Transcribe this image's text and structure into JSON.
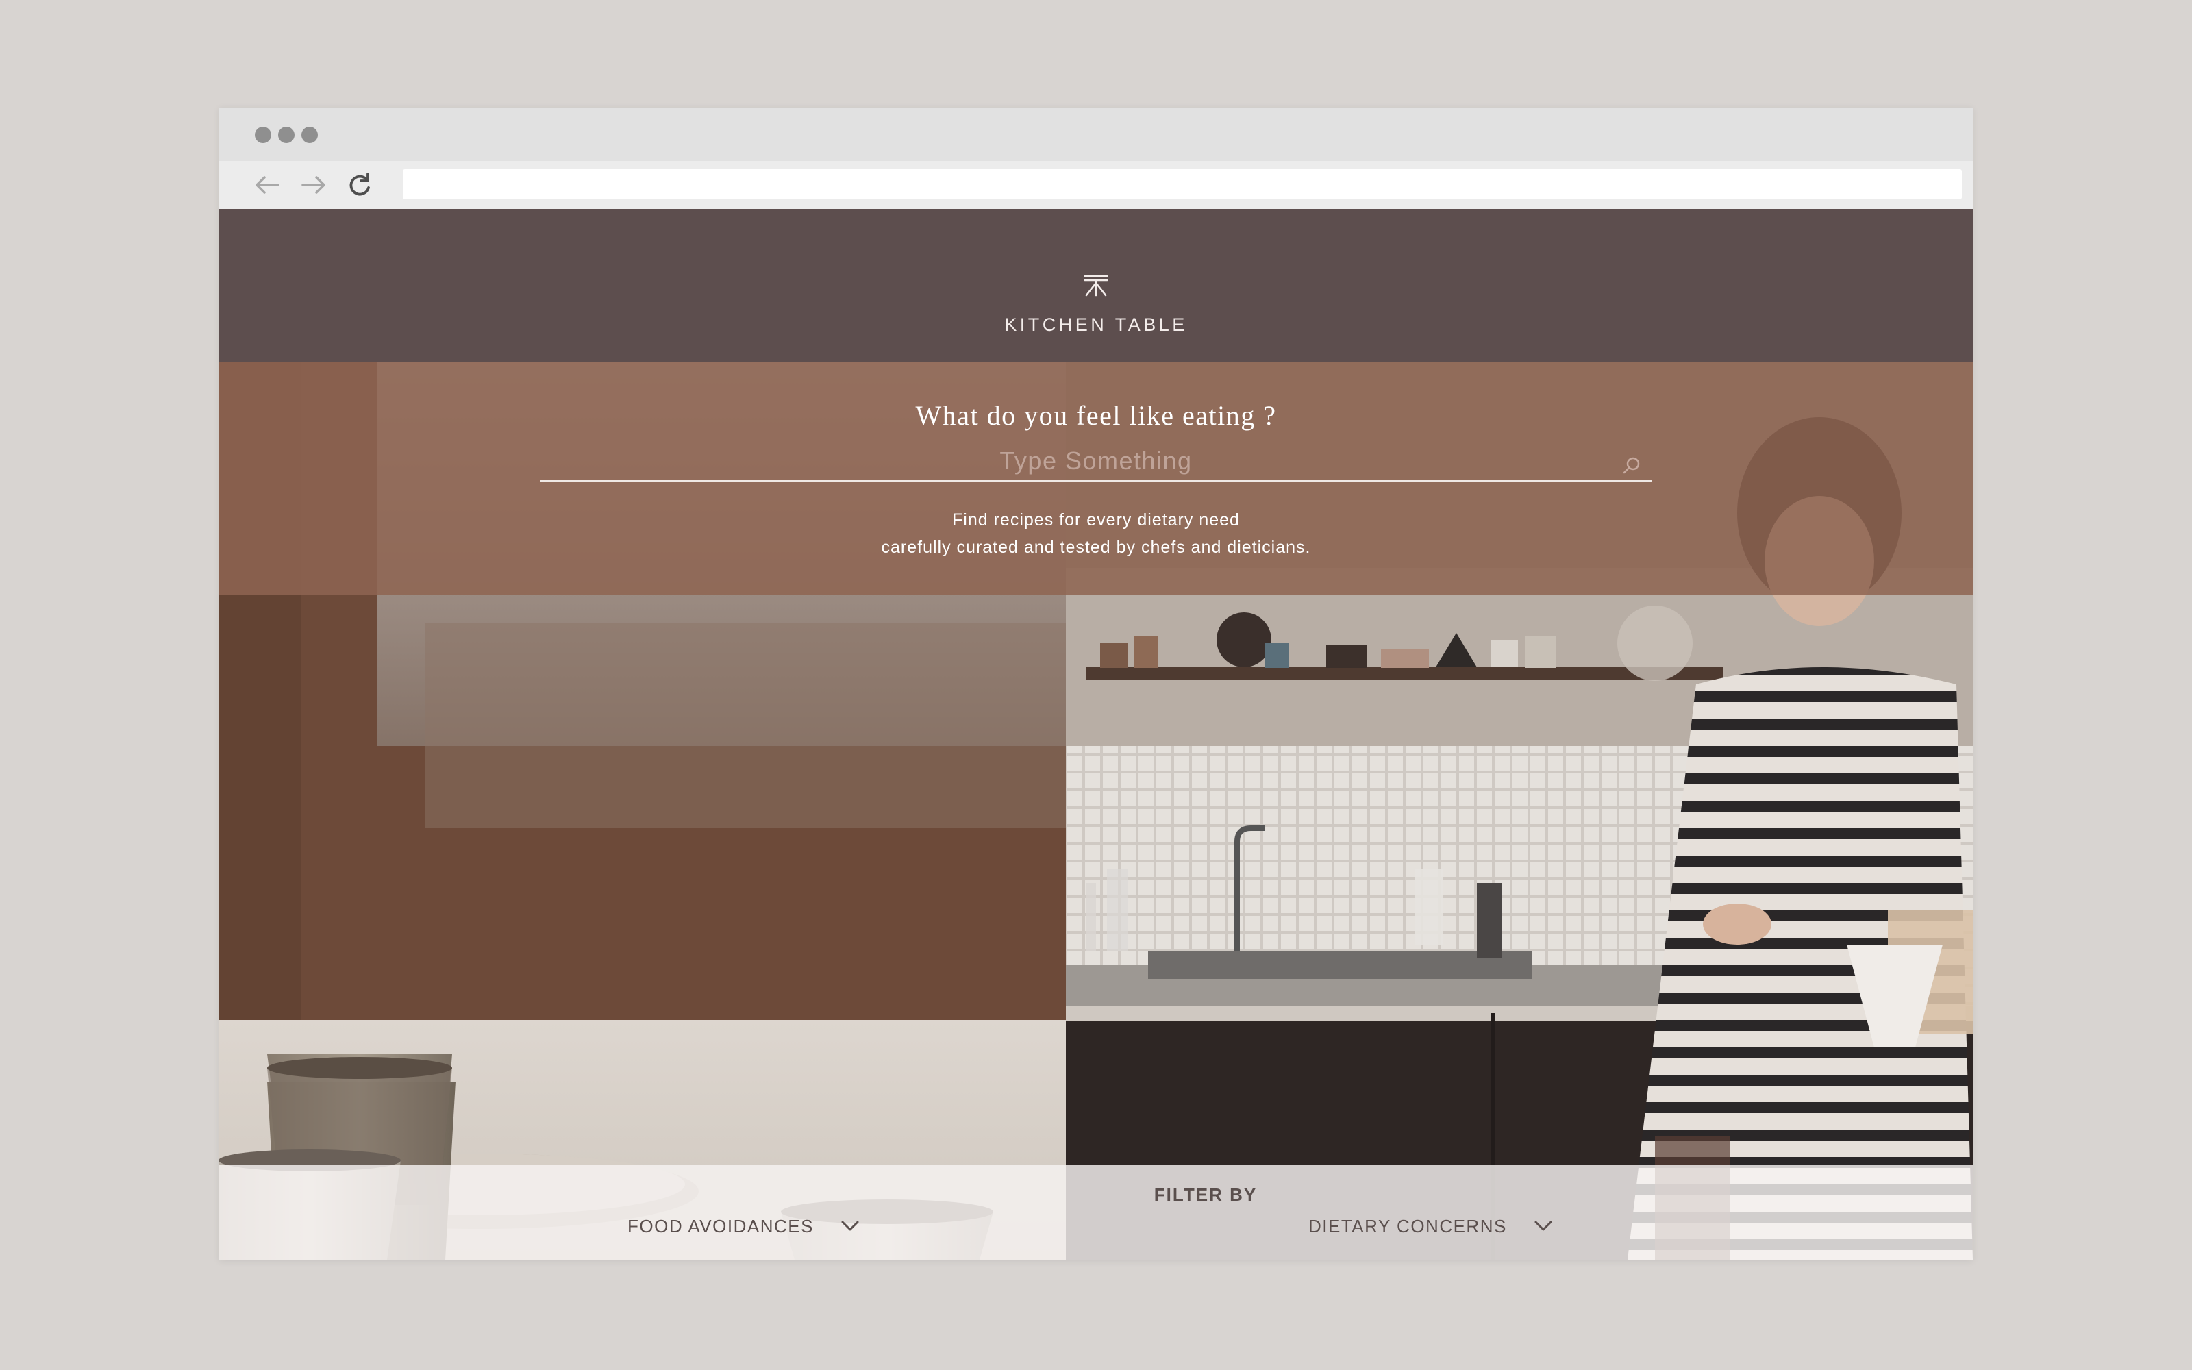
{
  "site": {
    "brand": "KITCHEN TABLE"
  },
  "hero": {
    "question": "What do you feel like eating ?",
    "search_placeholder": "Type Something",
    "tagline_line1": "Find recipes for every dietary need",
    "tagline_line2": "carefully curated and tested by chefs and dieticians."
  },
  "filter": {
    "title": "FILTER BY",
    "dropdowns": [
      {
        "label": "FOOD AVOIDANCES"
      },
      {
        "label": "DIETARY CONCERNS"
      }
    ]
  },
  "colors": {
    "page_background": "#d8d4d1",
    "header": "#5d4e4e",
    "hero_overlay": "#8e6452",
    "filter_text": "#5a4f4d"
  },
  "icons": {
    "window_controls": [
      "window-dot-icon",
      "window-dot-icon",
      "window-dot-icon"
    ],
    "toolbar": [
      "back-arrow-icon",
      "forward-arrow-icon",
      "reload-icon"
    ],
    "logo": "table-logo-icon",
    "search": "search-icon",
    "dropdown": "chevron-down-icon"
  }
}
